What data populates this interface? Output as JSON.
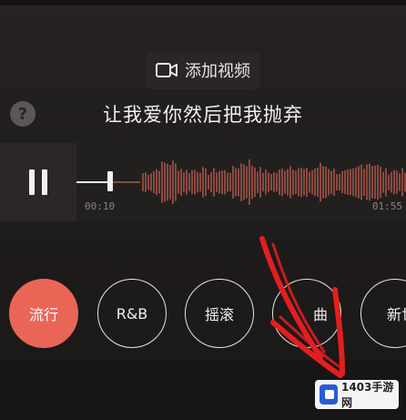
{
  "add_video": {
    "label": "添加视频",
    "icon": "video-camera-icon"
  },
  "help": {
    "icon": "help-icon",
    "glyph": "?"
  },
  "lyric": {
    "text": "让我爱你然后把我抛弃"
  },
  "player": {
    "state_icon": "pause-icon",
    "current_time": "00:10",
    "total_time": "01:55",
    "progress_fraction": 0.09
  },
  "genres": [
    {
      "label": "流行",
      "active": true
    },
    {
      "label": "R&B",
      "active": false
    },
    {
      "label": "摇滚",
      "active": false
    },
    {
      "label": "曲",
      "active": false
    },
    {
      "label": "新世",
      "active": false
    }
  ],
  "watermark": {
    "text": "1403手游网"
  },
  "colors": {
    "accent": "#e96657",
    "waveform": "#8a4a3f",
    "annotation_arrow": "#e21f1f"
  }
}
